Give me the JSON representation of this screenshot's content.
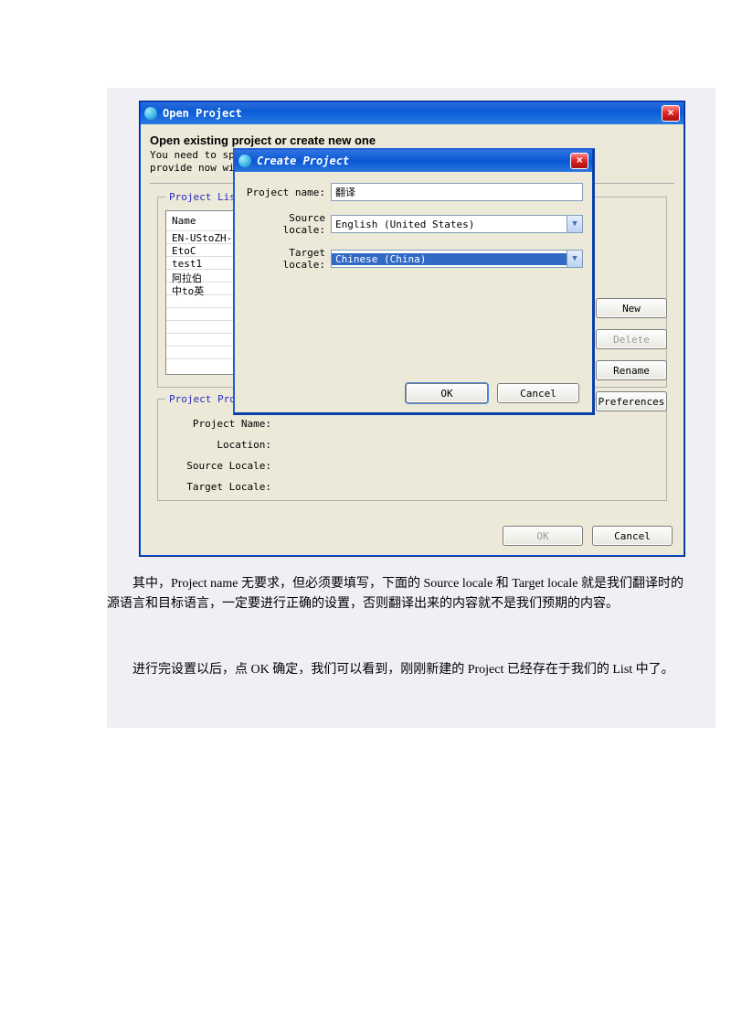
{
  "outer": {
    "title": "Open Project",
    "heading": "Open existing project or create new one",
    "description_line1": "You need to sp",
    "description_line2": "provide now wi",
    "projectListLegend": "Project List",
    "listHeader": "Name",
    "listItems": [
      "EN-UStoZH-C",
      "EtoC",
      "test1",
      "阿拉伯",
      "中to英"
    ],
    "propsLegend": "Project Prope",
    "props": {
      "projectNameLabel": "Project Name:",
      "locationLabel": "Location:",
      "sourceLocaleLabel": "Source Locale:",
      "targetLocaleLabel": "Target Locale:"
    },
    "sideButtons": {
      "new": "New",
      "delete": "Delete",
      "rename": "Rename",
      "preferences": "Preferences"
    },
    "footer": {
      "ok": "OK",
      "cancel": "Cancel"
    }
  },
  "inner": {
    "title": "Create Project",
    "projectNameLabel": "Project name:",
    "projectNameValue": "翻译",
    "sourceLocaleLabel": "Source locale:",
    "sourceLocaleValue": "English (United States)",
    "targetLocaleLabel": "Target locale:",
    "targetLocaleValue": "Chinese (China)",
    "ok": "OK",
    "cancel": "Cancel"
  },
  "bodyText": {
    "p1": "其中，Project name 无要求，但必须要填写，下面的 Source locale 和 Target locale 就是我们翻译时的源语言和目标语言，一定要进行正确的设置，否则翻译出来的内容就不是我们预期的内容。",
    "p2": "进行完设置以后，点 OK 确定，我们可以看到，刚刚新建的 Project 已经存在于我们的 List 中了。"
  }
}
